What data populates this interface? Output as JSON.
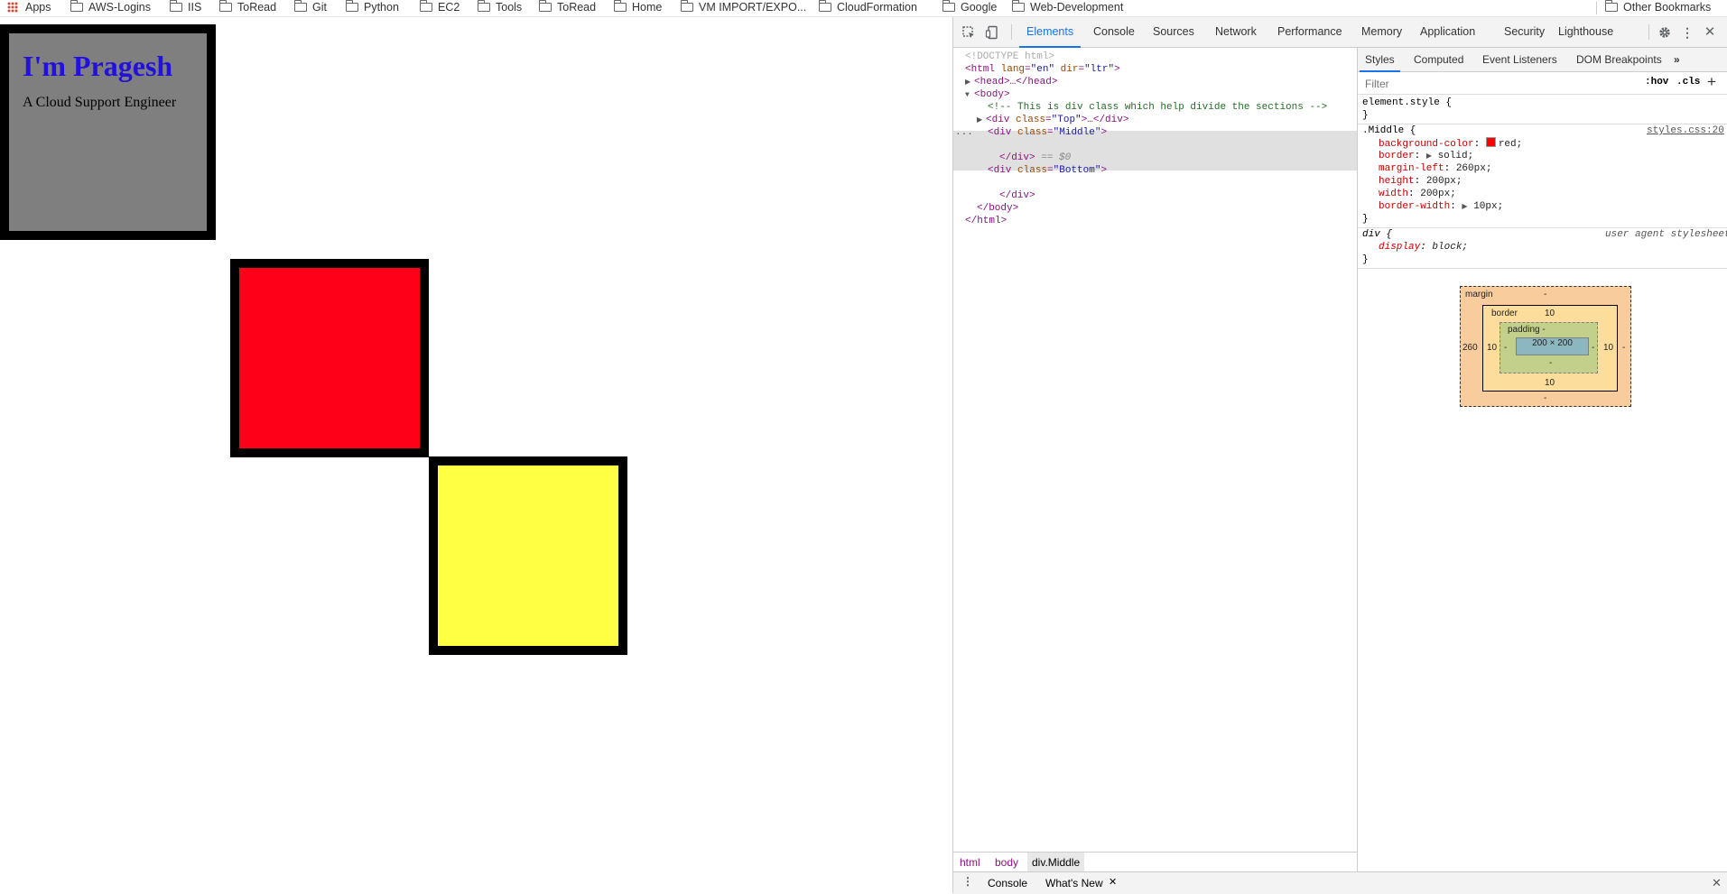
{
  "bookmarks": {
    "apps_label": "Apps",
    "items": [
      "AWS-Logins",
      "IIS",
      "ToRead",
      "Git",
      "Python",
      "EC2",
      "Tools",
      "ToRead",
      "Home",
      "VM IMPORT/EXPO...",
      "CloudFormation",
      "Google",
      "Web-Development"
    ],
    "other": "Other Bookmarks"
  },
  "page": {
    "heading": "I'm Pragesh",
    "subtitle": "A Cloud Support Engineer",
    "colors": {
      "top": "#808080",
      "middle": "#ff0019",
      "bottom": "#ffff44",
      "heading": "#2211dd"
    }
  },
  "devtools": {
    "tabs": [
      "Elements",
      "Console",
      "Sources",
      "Network",
      "Performance",
      "Memory",
      "Application",
      "Security",
      "Lighthouse"
    ],
    "active_tab": "Elements",
    "dom": {
      "doctype": "<!DOCTYPE html>",
      "html_open": "html",
      "lang_attr": "lang",
      "lang_val": "\"en\"",
      "dir_attr": "dir",
      "dir_val": "\"ltr\"",
      "head": "<head>…</head>",
      "body_open": "<body>",
      "comment": "<!-- This is div class which help divide the sections -->",
      "div_top_class": "\"Top\"",
      "div_middle_class": "\"Middle\"",
      "div_bottom_class": "\"Bottom\"",
      "div_close": "</div>",
      "sel_marker": "== $0",
      "body_close": "</body>",
      "html_close": "</html>",
      "dots": "..."
    },
    "breadcrumbs": [
      "html",
      "body",
      "div.Middle"
    ],
    "drawer": {
      "console": "Console",
      "whats_new": "What's New"
    },
    "styles": {
      "sub_tabs": [
        "Styles",
        "Computed",
        "Event Listeners",
        "DOM Breakpoints"
      ],
      "filter_placeholder": "Filter",
      "hov": ":hov",
      "cls": ".cls",
      "element_style": "element.style {",
      "close_brace": "}",
      "rule_selector": ".Middle {",
      "rule_source": "styles.css:20",
      "props": [
        {
          "name": "background-color",
          "value": "red;"
        },
        {
          "name": "border",
          "value": "solid;"
        },
        {
          "name": "margin-left",
          "value": "260px;"
        },
        {
          "name": "height",
          "value": "200px;"
        },
        {
          "name": "width",
          "value": "200px;"
        },
        {
          "name": "border-width",
          "value": "10px;"
        }
      ],
      "ua_selector": "div {",
      "ua_source": "user agent stylesheet",
      "ua_prop": "display",
      "ua_value": "block;"
    },
    "box_model": {
      "margin_label": "margin",
      "margin_top": "-",
      "margin_left": "260",
      "margin_right": "-",
      "margin_bottom": "-",
      "border_label": "border",
      "border_top": "10",
      "border_left": "10",
      "border_right": "10",
      "border_bottom": "10",
      "padding_label": "padding -",
      "padding_left": "-",
      "padding_right": "-",
      "padding_bottom": "-",
      "content": "200 × 200"
    }
  }
}
